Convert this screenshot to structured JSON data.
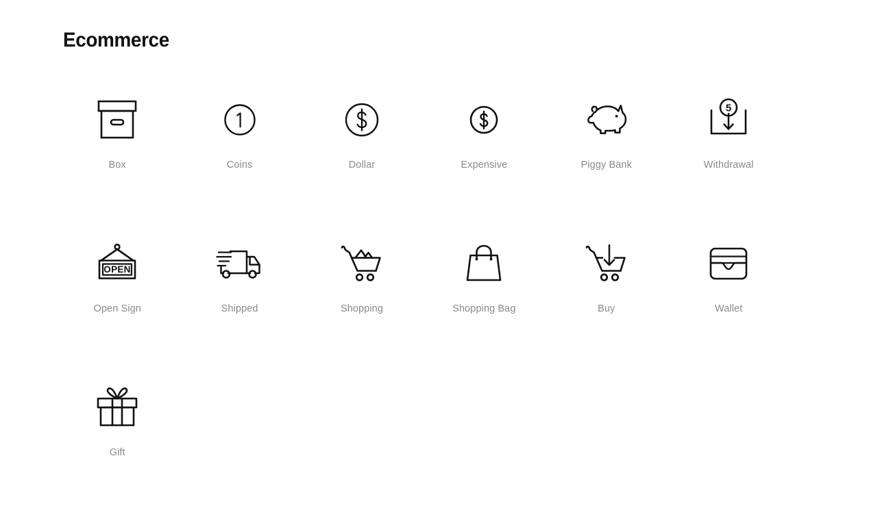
{
  "page": {
    "title": "Ecommerce",
    "background_color": "#ffffff",
    "icon_color": "#111111",
    "label_color": "#8a8a8a"
  },
  "icons": [
    {
      "name": "box",
      "label": "Box",
      "glyph": "box-icon"
    },
    {
      "name": "coins",
      "label": "Coins",
      "glyph": "coins-icon",
      "value": "1"
    },
    {
      "name": "dollar",
      "label": "Dollar",
      "glyph": "dollar-icon",
      "value": "$"
    },
    {
      "name": "expensive",
      "label": "Expensive",
      "glyph": "expensive-icon",
      "value": "$"
    },
    {
      "name": "piggy-bank",
      "label": "Piggy Bank",
      "glyph": "piggy-bank-icon"
    },
    {
      "name": "withdrawal",
      "label": "Withdrawal",
      "glyph": "withdrawal-icon",
      "value": "5"
    },
    {
      "name": "open-sign",
      "label": "Open Sign",
      "glyph": "open-sign-icon",
      "value": "OPEN"
    },
    {
      "name": "shipped",
      "label": "Shipped",
      "glyph": "shipped-icon"
    },
    {
      "name": "shopping",
      "label": "Shopping",
      "glyph": "shopping-cart-icon"
    },
    {
      "name": "shopping-bag",
      "label": "Shopping Bag",
      "glyph": "shopping-bag-icon"
    },
    {
      "name": "buy",
      "label": "Buy",
      "glyph": "buy-cart-icon"
    },
    {
      "name": "wallet",
      "label": "Wallet",
      "glyph": "wallet-icon"
    },
    {
      "name": "gift",
      "label": "Gift",
      "glyph": "gift-icon"
    }
  ]
}
